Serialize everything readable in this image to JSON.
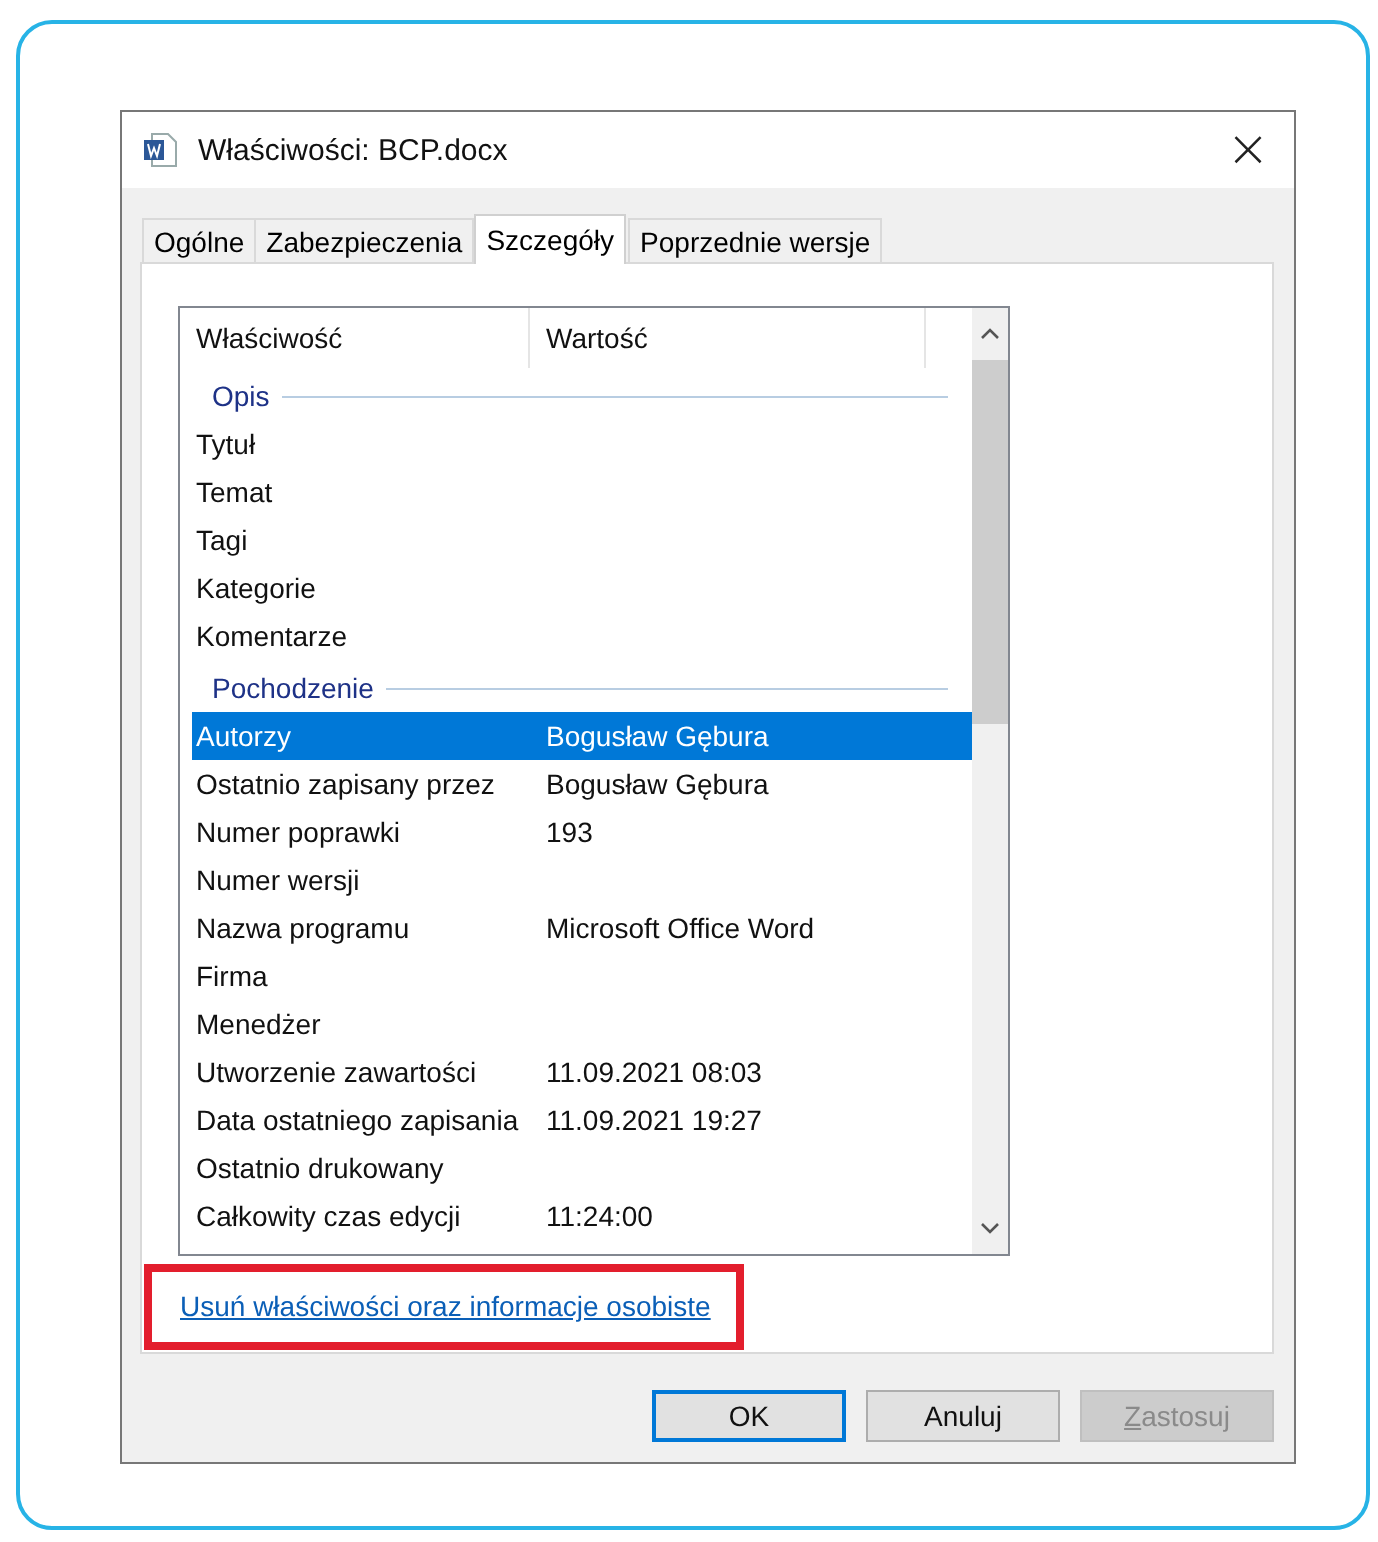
{
  "window": {
    "title": "Właściwości: BCP.docx",
    "close": "×"
  },
  "tabs": [
    {
      "label": "Ogólne",
      "selected": false
    },
    {
      "label": "Zabezpieczenia",
      "selected": false
    },
    {
      "label": "Szczegóły",
      "selected": true
    },
    {
      "label": "Poprzednie wersje",
      "selected": false
    }
  ],
  "table": {
    "columns": [
      "Właściwość",
      "Wartość"
    ],
    "rows": [
      {
        "kind": "group",
        "property": "Opis"
      },
      {
        "kind": "item",
        "property": "Tytuł",
        "value": "",
        "selected": false
      },
      {
        "kind": "item",
        "property": "Temat",
        "value": "",
        "selected": false
      },
      {
        "kind": "item",
        "property": "Tagi",
        "value": "",
        "selected": false
      },
      {
        "kind": "item",
        "property": "Kategorie",
        "value": "",
        "selected": false
      },
      {
        "kind": "item",
        "property": "Komentarze",
        "value": "",
        "selected": false
      },
      {
        "kind": "group",
        "property": "Pochodzenie"
      },
      {
        "kind": "item",
        "property": "Autorzy",
        "value": "Bogusław Gębura",
        "selected": true
      },
      {
        "kind": "item",
        "property": "Ostatnio zapisany przez",
        "value": "Bogusław Gębura",
        "selected": false
      },
      {
        "kind": "item",
        "property": "Numer poprawki",
        "value": "193",
        "selected": false
      },
      {
        "kind": "item",
        "property": "Numer wersji",
        "value": "",
        "selected": false
      },
      {
        "kind": "item",
        "property": "Nazwa programu",
        "value": "Microsoft Office Word",
        "selected": false
      },
      {
        "kind": "item",
        "property": "Firma",
        "value": "",
        "selected": false
      },
      {
        "kind": "item",
        "property": "Menedżer",
        "value": "",
        "selected": false
      },
      {
        "kind": "item",
        "property": "Utworzenie zawartości",
        "value": "11.09.2021 08:03",
        "selected": false
      },
      {
        "kind": "item",
        "property": "Data ostatniego zapisania",
        "value": "11.09.2021 19:27",
        "selected": false
      },
      {
        "kind": "item",
        "property": "Ostatnio drukowany",
        "value": "",
        "selected": false
      },
      {
        "kind": "item",
        "property": "Całkowity czas edycji",
        "value": "11:24:00",
        "selected": false
      }
    ]
  },
  "link": {
    "label": "Usuń właściwości oraz informacje osobiste",
    "highlighted": true
  },
  "buttons": [
    {
      "label": "OK",
      "default": true,
      "disabled": false
    },
    {
      "label": "Anuluj",
      "default": false,
      "disabled": false
    },
    {
      "label": "Zastosuj",
      "default": false,
      "disabled": true
    }
  ]
}
